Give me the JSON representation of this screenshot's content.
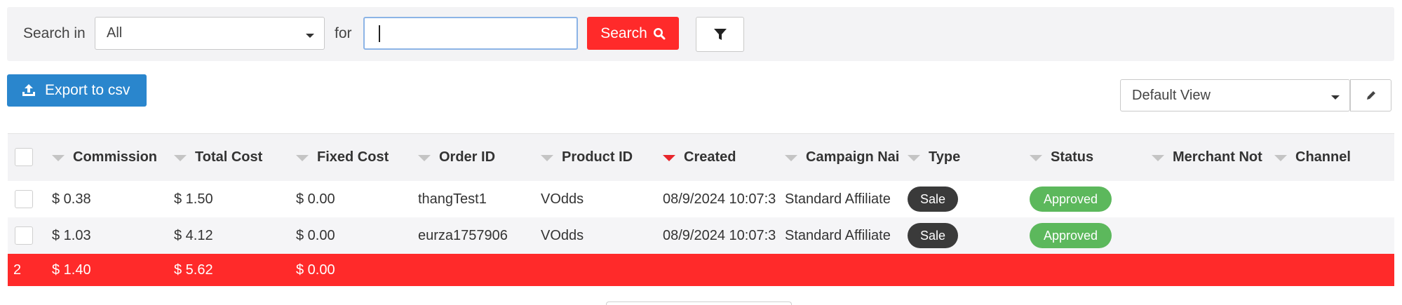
{
  "search": {
    "search_in_label": "Search in",
    "scope_value": "All",
    "for_label": "for",
    "query_value": "",
    "search_button_label": "Search"
  },
  "toolbar": {
    "export_label": "Export to csv",
    "view_value": "Default View"
  },
  "table": {
    "columns": [
      "Commission",
      "Total Cost",
      "Fixed Cost",
      "Order ID",
      "Product ID",
      "Created",
      "Campaign Nai",
      "Type",
      "Status",
      "Merchant Not",
      "Channel"
    ],
    "active_sort_column": "Created",
    "rows": [
      {
        "commission": "$ 0.38",
        "total_cost": "$ 1.50",
        "fixed_cost": "$ 0.00",
        "order_id": "thangTest1",
        "product_id": "VOdds",
        "created": "08/9/2024 10:07:3",
        "campaign": "Standard Affiliate",
        "type": "Sale",
        "status": "Approved"
      },
      {
        "commission": "$ 1.03",
        "total_cost": "$ 4.12",
        "fixed_cost": "$ 0.00",
        "order_id": "eurza1757906",
        "product_id": "VOdds",
        "created": "08/9/2024 10:07:3",
        "campaign": "Standard Affiliate",
        "type": "Sale",
        "status": "Approved"
      }
    ],
    "totals": {
      "count": "2",
      "commission": "$ 1.40",
      "total_cost": "$ 5.62",
      "fixed_cost": "$ 0.00"
    }
  },
  "colors": {
    "primary_red": "#ff2a2a",
    "export_blue": "#2a86cd",
    "approved_green": "#5cb85c",
    "type_dark": "#3a3a3a"
  },
  "icons": {
    "search": "search-icon",
    "filter": "filter-icon",
    "export": "upload-icon",
    "edit": "pencil-icon",
    "sort": "chevron-down-icon"
  }
}
